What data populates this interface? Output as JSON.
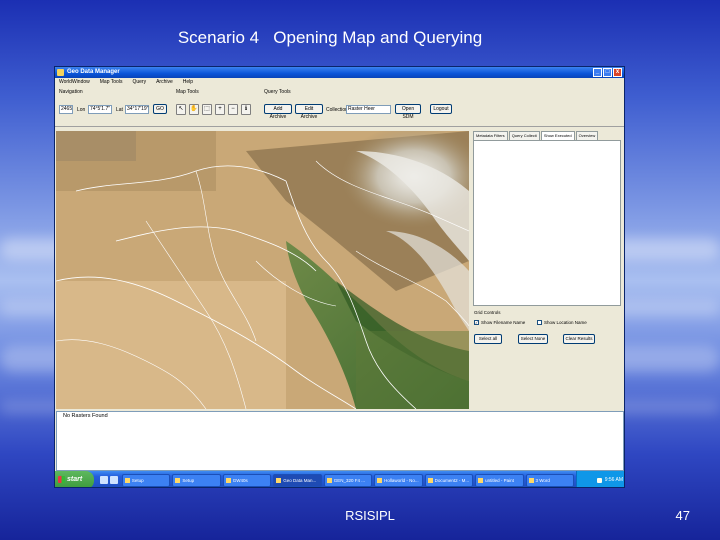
{
  "slide": {
    "title": "Scenario 4   Opening Map and Querying",
    "footer_center": "RSISIPL",
    "page_number": "47"
  },
  "window": {
    "title": "Geo Data Manager",
    "buttons": [
      "_",
      "□",
      "x"
    ],
    "menu": [
      "WorldWindow",
      "Map Tools",
      "Query",
      "Archive",
      "Help"
    ]
  },
  "navigation": {
    "label": "Navigation",
    "zoom_value": "2465",
    "lon_label": "Lon",
    "lon_value": "74°5'1.7\"",
    "lat_label": "Lat",
    "lat_value": "34°17'19\"",
    "go_label": "GO"
  },
  "map_tools": {
    "label": "Map Tools",
    "icons": [
      "pointer-icon",
      "hand-icon",
      "select-icon",
      "zoom-icon",
      "zoom-out-icon",
      "identify-icon"
    ]
  },
  "query_tools": {
    "label": "Query Tools",
    "add_archive": "Add Archive",
    "edit_archive": "Edit Archive",
    "collection_label": "Collection",
    "collection_value": "Raster Heer",
    "open_sdm": "Open SDM",
    "logout": "Logout"
  },
  "right_panel": {
    "tabs": [
      "Metadata Filters",
      "Query Collecti",
      "Show Executed",
      "Overview"
    ],
    "active_tab": 2,
    "grid_controls_label": "Grid Controls",
    "show_filename": "Show Filename Name",
    "show_location": "Show Location Name",
    "buttons": [
      "Select all",
      "Select None",
      "Clear Results"
    ]
  },
  "status": {
    "message": "No Rasters Found"
  },
  "taskbar": {
    "start_label": "start",
    "items": [
      "Setup",
      "Setup",
      "GW40s",
      "Geo Data Man...",
      "GEN_320 F4 ...",
      "Hollaworld - No...",
      "Document2 - M...",
      "untitled - Paint",
      "3 Word"
    ],
    "active_index": 3,
    "clock": "9:56 AM"
  }
}
